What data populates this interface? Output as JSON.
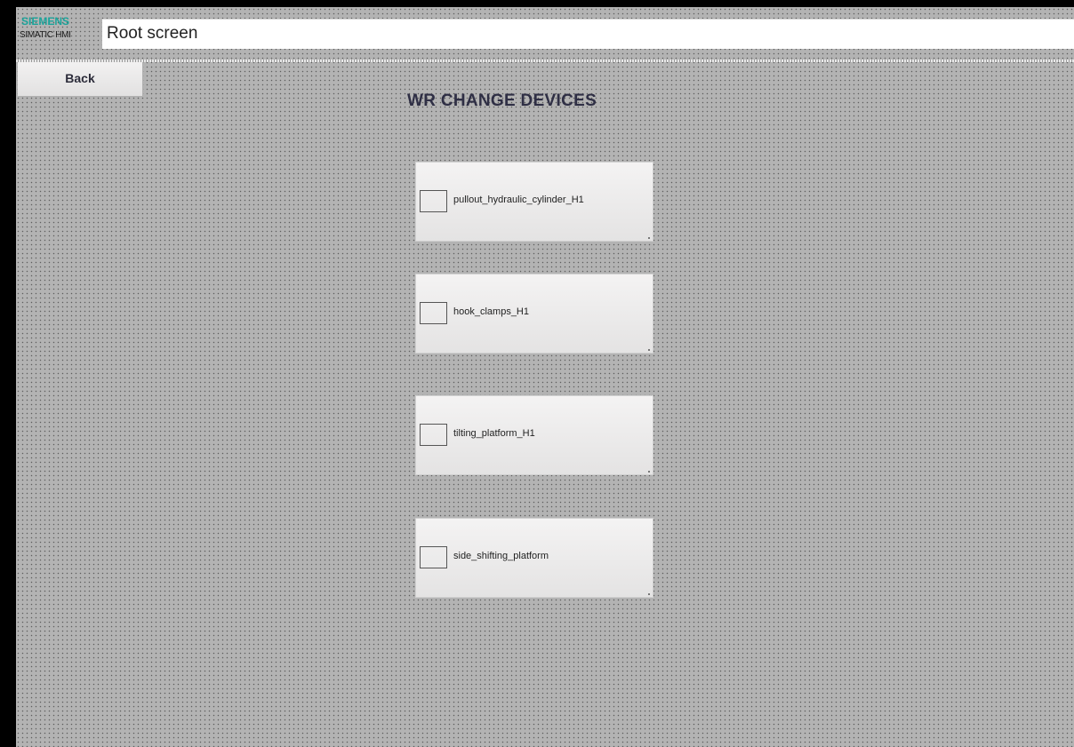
{
  "header": {
    "brand": "SIEMENS",
    "product": "SIMATIC HMI",
    "title": "Root screen"
  },
  "nav": {
    "back_label": "Back"
  },
  "main": {
    "title": "WR CHANGE DEVICES",
    "devices": [
      {
        "label": "pullout_hydraulic_cylinder_H1"
      },
      {
        "label": "hook_clamps_H1"
      },
      {
        "label": "tilting_platform_H1"
      },
      {
        "label": "side_shifting_platform"
      }
    ]
  },
  "colors": {
    "brand": "#1aa39a",
    "background": "#b3b3b3",
    "title_bar": "#ffffff",
    "button": "#ebeaea",
    "title_text": "#2f2f45"
  }
}
